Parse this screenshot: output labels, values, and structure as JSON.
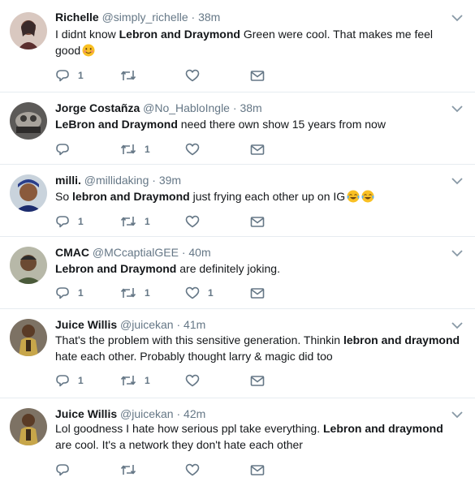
{
  "tweets": [
    {
      "name": "Richelle",
      "handle": "@simply_richelle",
      "time": "38m",
      "text_parts": [
        {
          "t": "I didnt know ",
          "b": false
        },
        {
          "t": "Lebron and Draymond",
          "b": true
        },
        {
          "t": " Green were cool. That makes me feel good",
          "b": false
        }
      ],
      "emoji": [
        "smiling-face-emoji"
      ],
      "replies": "1",
      "retweets": "",
      "likes": ""
    },
    {
      "name": "Jorge Costañza",
      "handle": "@No_HabloIngle",
      "time": "38m",
      "text_parts": [
        {
          "t": "LeBron and Draymond",
          "b": true
        },
        {
          "t": " need there own show 15 years from now",
          "b": false
        }
      ],
      "emoji": [],
      "replies": "",
      "retweets": "1",
      "likes": ""
    },
    {
      "name": "milli.",
      "handle": "@millidaking",
      "time": "39m",
      "text_parts": [
        {
          "t": "So ",
          "b": false
        },
        {
          "t": "lebron and Draymond",
          "b": true
        },
        {
          "t": " just frying each other up on IG",
          "b": false
        }
      ],
      "emoji": [
        "tears-of-joy-emoji",
        "tears-of-joy-emoji"
      ],
      "replies": "1",
      "retweets": "1",
      "likes": ""
    },
    {
      "name": "CMAC",
      "handle": "@MCcaptialGEE",
      "time": "40m",
      "text_parts": [
        {
          "t": "Lebron and Draymond",
          "b": true
        },
        {
          "t": " are definitely joking.",
          "b": false
        }
      ],
      "emoji": [],
      "replies": "1",
      "retweets": "1",
      "likes": "1"
    },
    {
      "name": "Juice Willis",
      "handle": "@juicekan",
      "time": "41m",
      "text_parts": [
        {
          "t": "That's the problem with this sensitive generation. Thinkin ",
          "b": false
        },
        {
          "t": "lebron and draymond",
          "b": true
        },
        {
          "t": " hate each other. Probably thought larry & magic did too",
          "b": false
        }
      ],
      "emoji": [],
      "replies": "1",
      "retweets": "1",
      "likes": ""
    },
    {
      "name": "Juice Willis",
      "handle": "@juicekan",
      "time": "42m",
      "text_parts": [
        {
          "t": "Lol goodness I hate how serious ppl take everything. ",
          "b": false
        },
        {
          "t": "Lebron and draymond",
          "b": true
        },
        {
          "t": " are cool. It's a network they don't hate each other",
          "b": false
        }
      ],
      "emoji": [],
      "replies": "",
      "retweets": "",
      "likes": ""
    }
  ],
  "separator": "·",
  "colors": {
    "text": "#14171a",
    "secondary": "#657786",
    "border": "#e6ecf0"
  }
}
